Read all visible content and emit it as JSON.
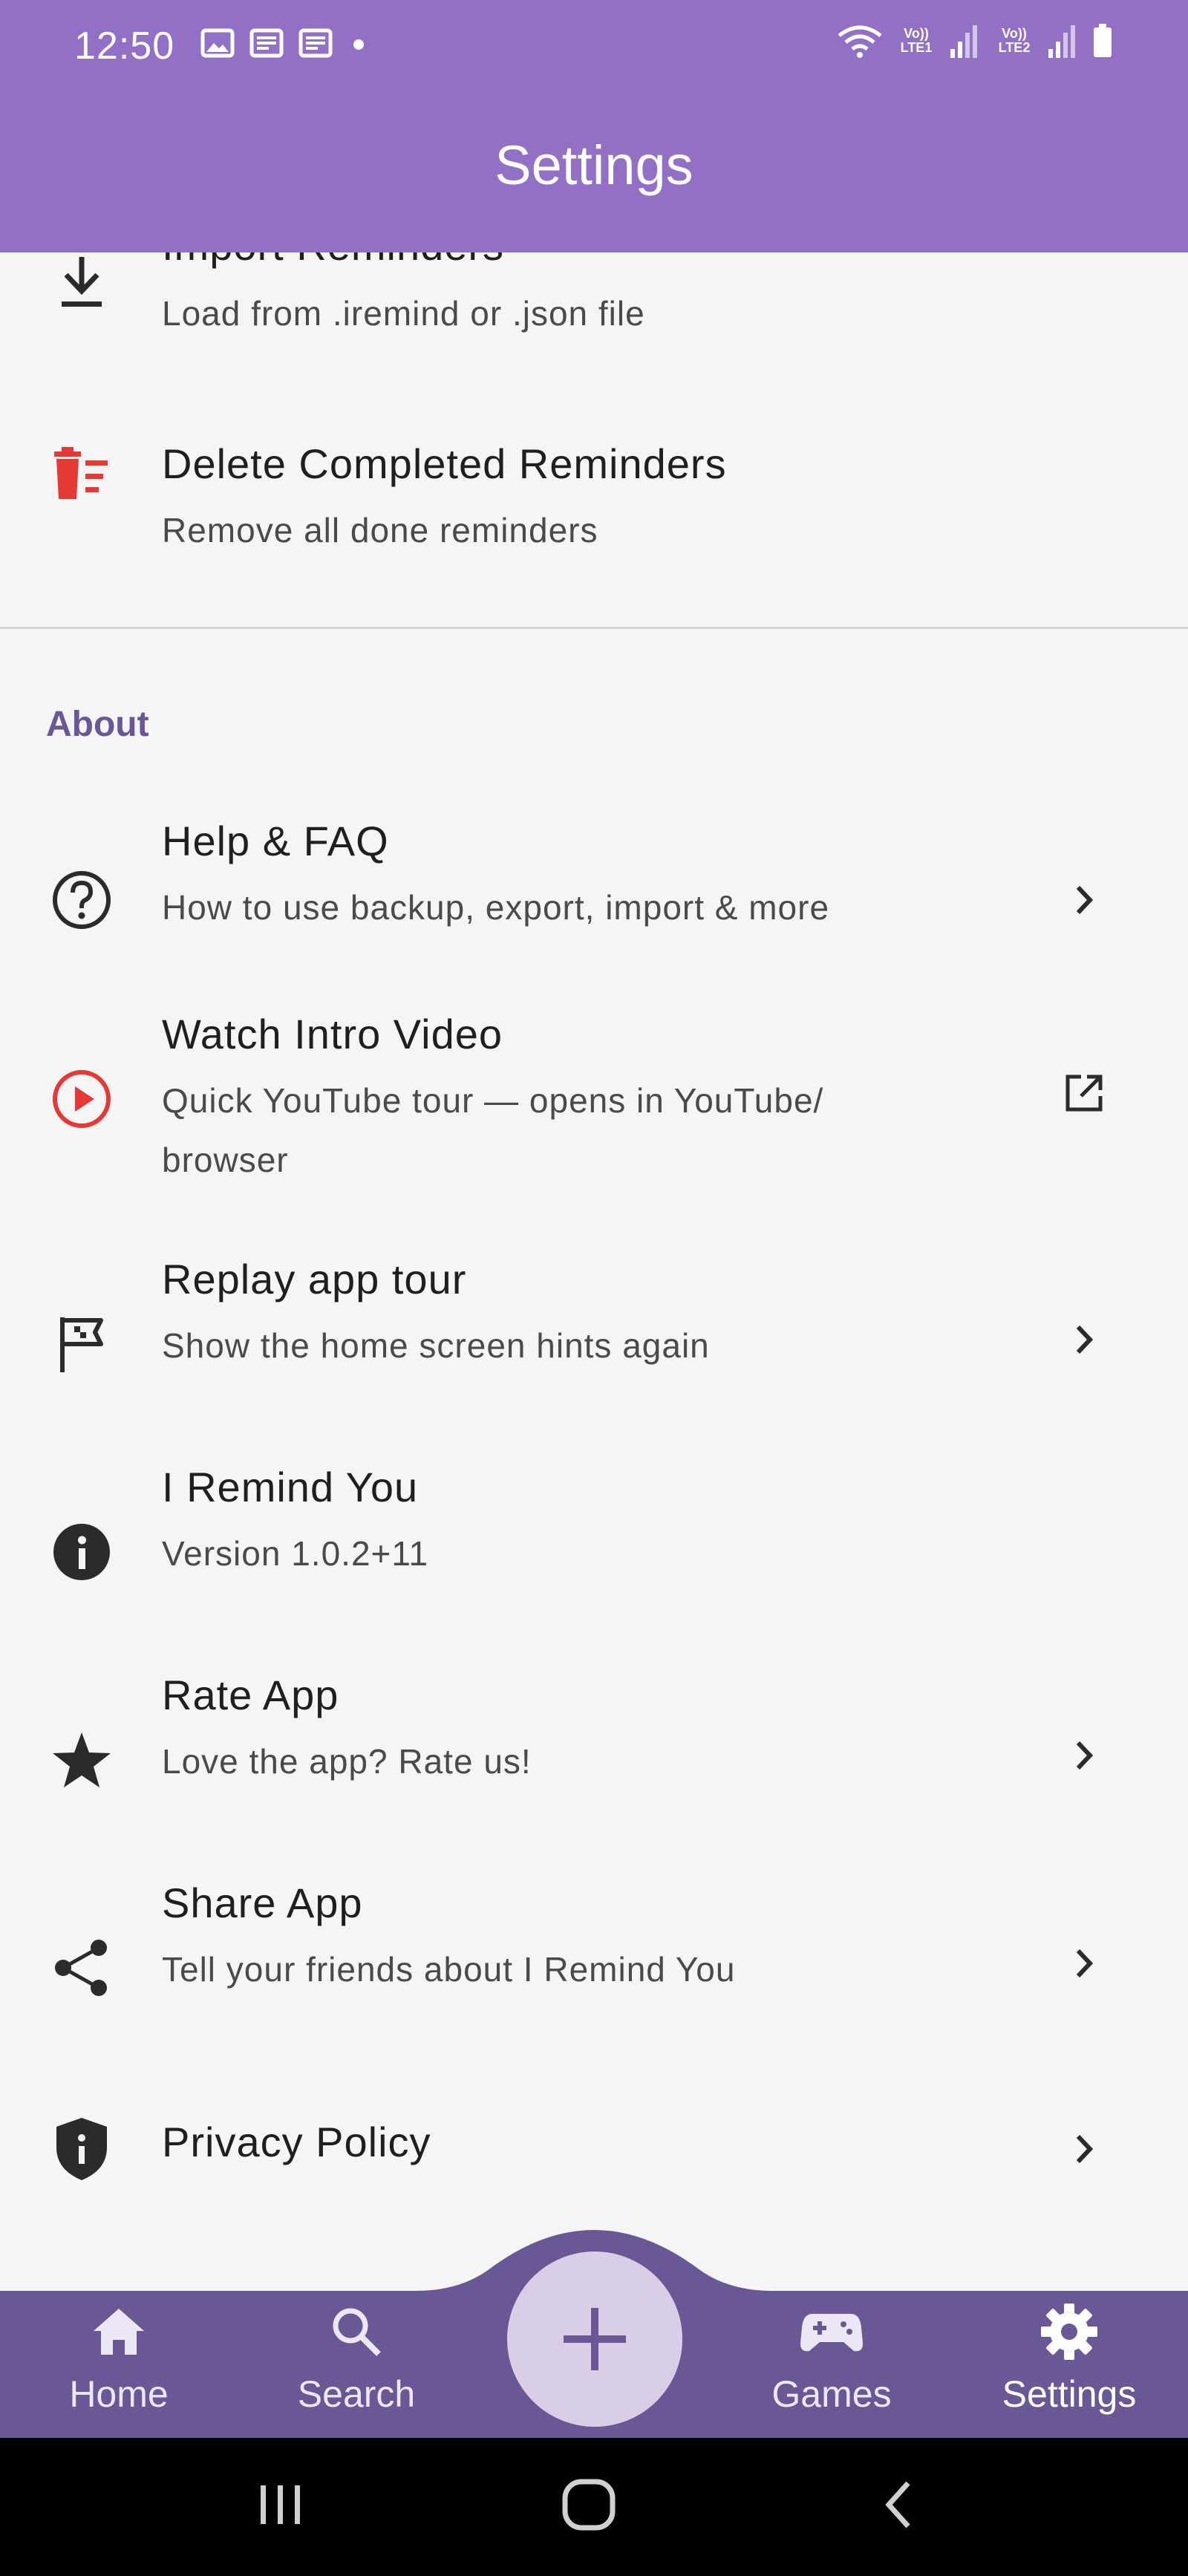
{
  "status_bar": {
    "time": "12:50",
    "notification_icons": [
      "gallery-icon",
      "news-icon",
      "news-icon",
      "dot-icon"
    ],
    "sim1": "Vo)) LTE1",
    "sim2": "Vo)) LTE2"
  },
  "app_bar": {
    "title": "Settings"
  },
  "list": {
    "import": {
      "title": "Import Reminders",
      "subtitle": "Load from .iremind or .json file",
      "icon": "download-icon"
    },
    "delete": {
      "title": "Delete Completed Reminders",
      "subtitle": "Remove all done reminders",
      "icon": "delete-sweep-icon",
      "icon_color": "#e53935"
    },
    "about_header": "About",
    "help": {
      "title": "Help & FAQ",
      "subtitle": "How to use backup, export, import & more",
      "icon": "help-circle-icon",
      "trailing": "chevron-right-icon"
    },
    "video": {
      "title": "Watch Intro Video",
      "subtitle_line1": "Quick YouTube tour — opens in YouTube/",
      "subtitle_line2": "browser",
      "icon": "play-circle-icon",
      "icon_color": "#e53935",
      "trailing": "open-external-icon"
    },
    "tour": {
      "title": "Replay app tour",
      "subtitle": "Show the home screen hints again",
      "icon": "tour-flag-icon",
      "trailing": "chevron-right-icon"
    },
    "version": {
      "title": "I Remind You",
      "subtitle": "Version 1.0.2+11",
      "icon": "info-icon"
    },
    "rate": {
      "title": "Rate App",
      "subtitle": "Love the app? Rate us!",
      "icon": "star-icon",
      "trailing": "chevron-right-icon"
    },
    "share": {
      "title": "Share App",
      "subtitle": "Tell your friends about I Remind You",
      "icon": "share-icon",
      "trailing": "chevron-right-icon"
    },
    "privacy": {
      "title": "Privacy Policy",
      "icon": "shield-icon",
      "trailing": "chevron-right-icon"
    }
  },
  "bottom_nav": {
    "items": [
      {
        "label": "Home",
        "icon": "home-icon"
      },
      {
        "label": "Search",
        "icon": "search-icon"
      },
      {
        "label": "Games",
        "icon": "gamepad-icon"
      },
      {
        "label": "Settings",
        "icon": "gear-icon"
      }
    ],
    "active": "Settings",
    "fab_icon": "plus-icon"
  },
  "colors": {
    "app_bar": "#9270c6",
    "bottom_nav": "#6a5796",
    "fab": "#d8cfe6",
    "section_header": "#6a5896",
    "danger": "#e53935"
  }
}
